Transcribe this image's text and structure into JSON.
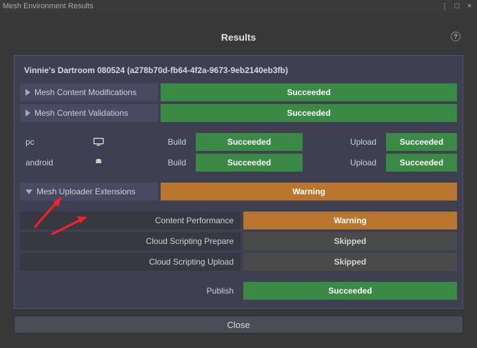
{
  "window": {
    "title": "Mesh Environment Results",
    "menu_glyph": "⋮",
    "max_glyph": "□",
    "close_glyph": "×"
  },
  "header": {
    "title": "Results",
    "help_glyph": "?"
  },
  "session": {
    "name": "Vinnie's Dartroom 080524 (a278b70d-fb64-4f2a-9673-9eb2140eb3fb)"
  },
  "rows": {
    "modifications": {
      "label": "Mesh Content Modifications",
      "status": "Succeeded",
      "status_kind": "success"
    },
    "validations": {
      "label": "Mesh Content Validations",
      "status": "Succeeded",
      "status_kind": "success"
    },
    "extensions": {
      "label": "Mesh Uploader Extensions",
      "status": "Warning",
      "status_kind": "warning"
    },
    "content_perf": {
      "label": "Content Performance",
      "status": "Warning",
      "status_kind": "warning"
    },
    "script_prep": {
      "label": "Cloud Scripting Prepare",
      "status": "Skipped",
      "status_kind": "skipped"
    },
    "script_upload": {
      "label": "Cloud Scripting Upload",
      "status": "Skipped",
      "status_kind": "skipped"
    },
    "publish": {
      "label": "Publish",
      "status": "Succeeded",
      "status_kind": "success"
    }
  },
  "platforms": {
    "build_label": "Build",
    "upload_label": "Upload",
    "pc": {
      "label": "pc",
      "build_status": "Succeeded",
      "upload_status": "Succeeded"
    },
    "android": {
      "label": "android",
      "build_status": "Succeeded",
      "upload_status": "Succeeded"
    }
  },
  "footer": {
    "close_label": "Close"
  },
  "colors": {
    "success": "#3a8a46",
    "warning": "#b9762f",
    "skipped": "#4a4a4a",
    "panel": "#3f3f52",
    "accent_border": "#55557a"
  }
}
